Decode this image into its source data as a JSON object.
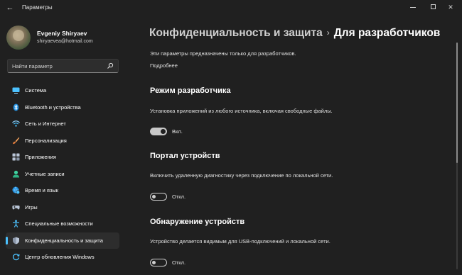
{
  "window": {
    "title": "Параметры",
    "back_glyph": "←",
    "close_glyph": "✕"
  },
  "user": {
    "name": "Evgeniy Shiryaev",
    "email": "shiryaevea@hotmail.com"
  },
  "search": {
    "placeholder": "Найти параметр"
  },
  "sidebar": {
    "items": [
      {
        "label": "Система",
        "icon": "monitor-icon",
        "color": "#4cc2ff"
      },
      {
        "label": "Bluetooth и устройства",
        "icon": "bluetooth-icon",
        "color": "#4cc2ff"
      },
      {
        "label": "Сеть и Интернет",
        "icon": "wifi-icon",
        "color": "#8fd3ff"
      },
      {
        "label": "Персонализация",
        "icon": "brush-icon",
        "color": "#f7a35c"
      },
      {
        "label": "Приложения",
        "icon": "apps-icon",
        "color": "#b9c5d6"
      },
      {
        "label": "Учетные записи",
        "icon": "person-icon",
        "color": "#3fd1a0"
      },
      {
        "label": "Время и язык",
        "icon": "globe-clock-icon",
        "color": "#4cc2ff"
      },
      {
        "label": "Игры",
        "icon": "gamepad-icon",
        "color": "#b9c5d6"
      },
      {
        "label": "Специальные возможности",
        "icon": "accessibility-icon",
        "color": "#4cc2ff"
      },
      {
        "label": "Конфиденциальность и защита",
        "icon": "shield-icon",
        "color": "#b9c5d6",
        "active": true
      },
      {
        "label": "Центр обновления Windows",
        "icon": "update-icon",
        "color": "#4cc2ff"
      }
    ]
  },
  "breadcrumb": {
    "parent": "Конфиденциальность и защита",
    "separator": "›",
    "current": "Для разработчиков"
  },
  "intro": {
    "text": "Эти параметры предназначены только для разработчиков.",
    "link": "Подробнее"
  },
  "sections": [
    {
      "title": "Режим разработчика",
      "description": "Установка приложений из любого источника, включая свободные файлы.",
      "toggle_on": true,
      "toggle_label": "Вкл."
    },
    {
      "title": "Портал устройств",
      "description": "Включить удаленную диагностику через подключение по локальной сети.",
      "toggle_on": false,
      "toggle_label": "Откл."
    },
    {
      "title": "Обнаружение устройств",
      "description": "Устройство делается видимым для USB-подключений и локальной сети.",
      "toggle_on": false,
      "toggle_label": "Откл."
    }
  ],
  "colors": {
    "background": "#202020",
    "accent": "#4cc2ff",
    "active_item": "#2d2d2d"
  }
}
